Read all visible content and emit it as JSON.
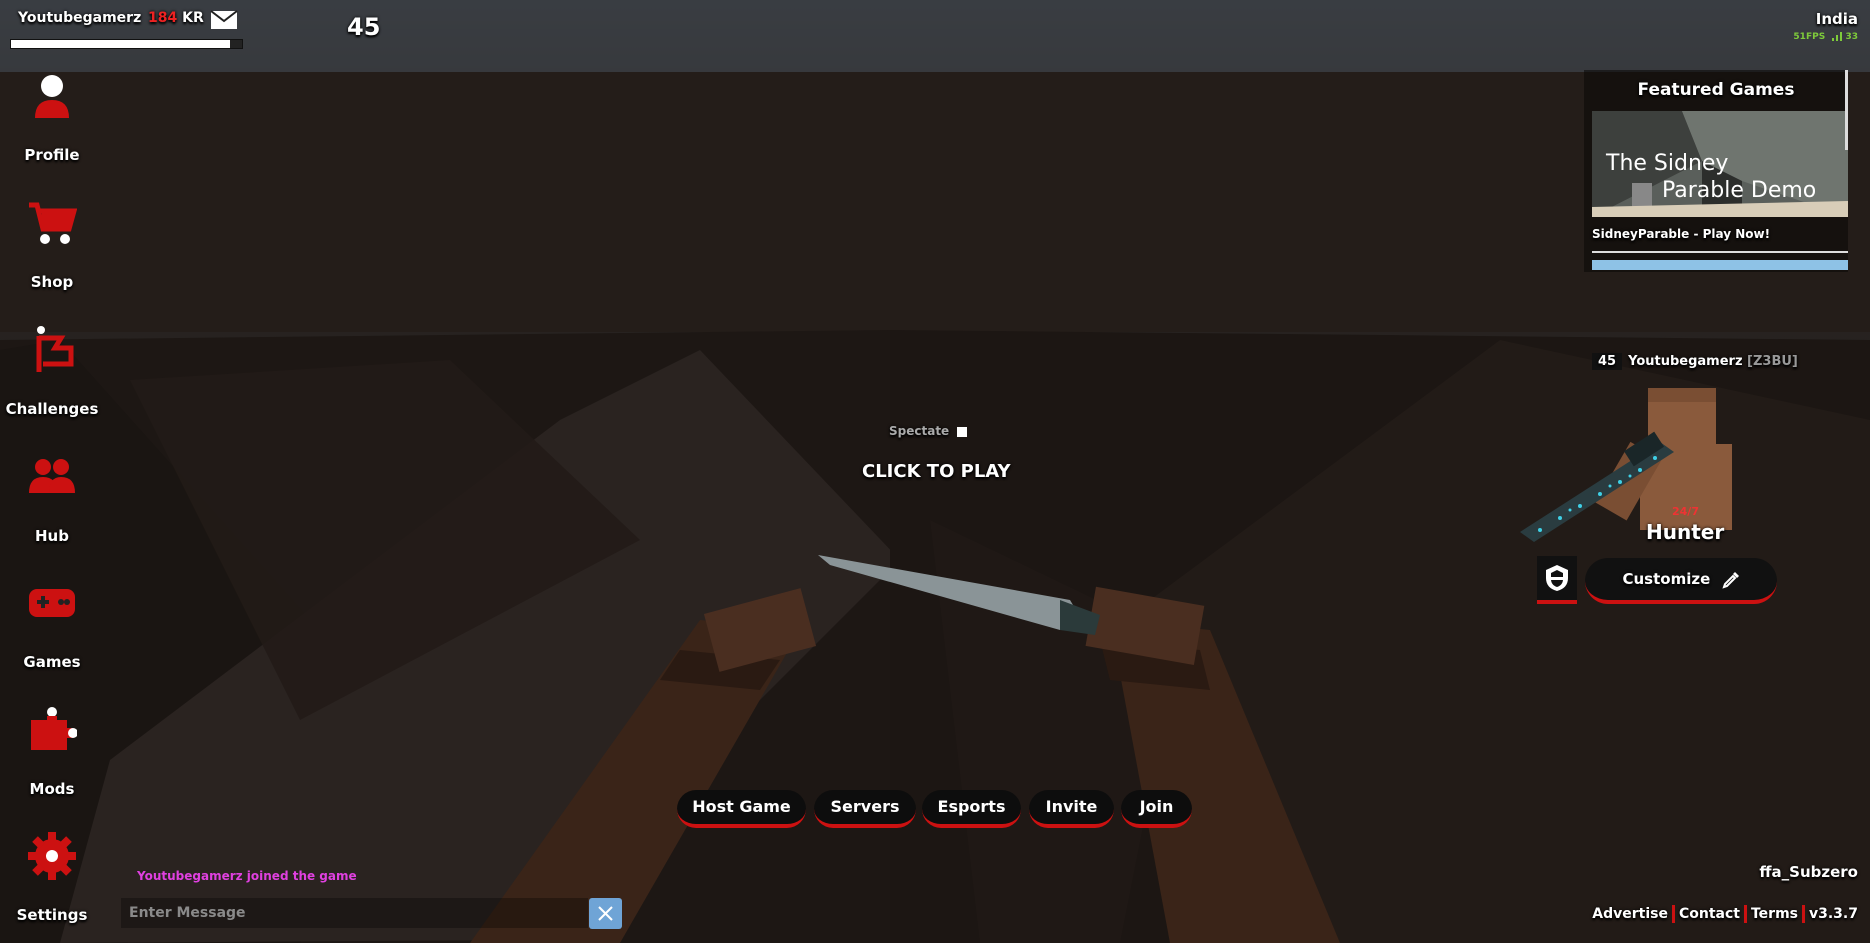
{
  "hud": {
    "username": "Youtubegamerz",
    "kr_value": "184",
    "kr_unit": "KR",
    "xp_progress": 0.95,
    "level": "45"
  },
  "sidebar": {
    "items": [
      {
        "label": "Profile",
        "icon": "profile-icon"
      },
      {
        "label": "Shop",
        "icon": "cart-icon"
      },
      {
        "label": "Challenges",
        "icon": "flag-icon"
      },
      {
        "label": "Hub",
        "icon": "people-icon"
      },
      {
        "label": "Games",
        "icon": "gamepad-icon"
      },
      {
        "label": "Mods",
        "icon": "puzzle-icon"
      },
      {
        "label": "Settings",
        "icon": "gear-icon"
      }
    ]
  },
  "topright": {
    "region": "India",
    "fps": "51FPS",
    "ping": "33"
  },
  "featured": {
    "title": "Featured Games",
    "image_text_line1": "The Sidney",
    "image_text_line2": "Parable Demo",
    "link": "SidneyParable - Play Now!"
  },
  "player": {
    "level": "45",
    "name": "Youtubegamerz",
    "clan": "[Z3BU]",
    "class_tag": "24/7",
    "class_name": "Hunter",
    "customize_label": "Customize"
  },
  "center": {
    "spectate_label": "Spectate",
    "click_to_play": "CLICK TO PLAY"
  },
  "bottom_buttons": [
    "Host Game",
    "Servers",
    "Esports",
    "Invite",
    "Join"
  ],
  "chat": {
    "message": "Youtubegamerz joined the game",
    "placeholder": "Enter Message"
  },
  "map": {
    "name": "ffa_Subzero"
  },
  "footer": {
    "links": [
      "Advertise",
      "Contact",
      "Terms",
      "v3.3.7"
    ]
  },
  "colors": {
    "accent": "#cc1111",
    "chat_system": "#e040e0",
    "net_green": "#7ecb3a",
    "close_button": "#6fa4d6"
  }
}
